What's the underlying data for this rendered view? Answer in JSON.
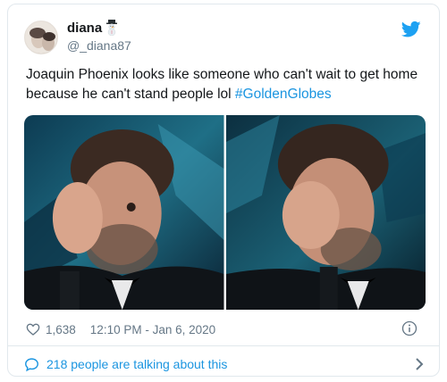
{
  "user": {
    "display_name": "diana",
    "handle": "@_diana87"
  },
  "tweet": {
    "text_before_hashtag": "Joaquin Phoenix looks like someone who can't wait to get home because he can't stand people lol ",
    "hashtag": "#GoldenGlobes"
  },
  "media": {
    "photos": [
      {
        "subject": "man holding hand over one eye at an awards show"
      },
      {
        "subject": "man covering face with hand at an awards show"
      }
    ]
  },
  "meta": {
    "like_count": "1,638",
    "timestamp": "12:10 PM - Jan 6, 2020"
  },
  "footer": {
    "talking_text": "218 people are talking about this"
  },
  "colors": {
    "accent": "#1b95e0",
    "twitter_blue": "#1da1f2",
    "muted": "#657786",
    "border": "#e1e8ed"
  },
  "icons": [
    "snowman-icon",
    "twitter-bird-icon",
    "heart-icon",
    "info-icon",
    "chat-icon",
    "chevron-right-icon"
  ]
}
